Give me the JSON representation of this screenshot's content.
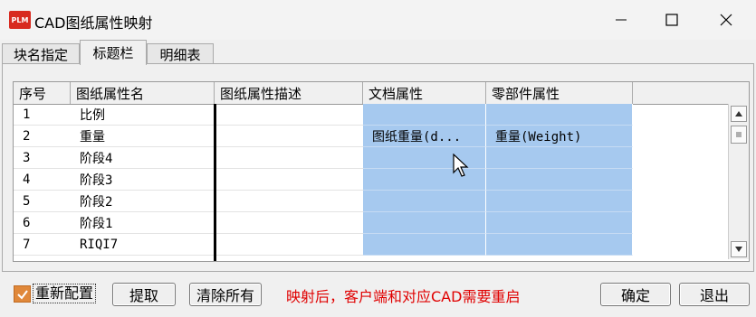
{
  "window": {
    "app_icon_text": "PLM",
    "title": "CAD图纸属性映射"
  },
  "tabs": [
    {
      "label": "块名指定",
      "active": false
    },
    {
      "label": "标题栏",
      "active": true
    },
    {
      "label": "明细表",
      "active": false
    }
  ],
  "table": {
    "columns": [
      "序号",
      "图纸属性名",
      "图纸属性描述",
      "文档属性",
      "零部件属性"
    ],
    "rows": [
      {
        "index": "1",
        "name": "比例",
        "desc": "",
        "doc": "",
        "part": ""
      },
      {
        "index": "2",
        "name": "重量",
        "desc": "",
        "doc": "图纸重量(d...",
        "part": "重量(Weight)"
      },
      {
        "index": "3",
        "name": "阶段4",
        "desc": "",
        "doc": "",
        "part": ""
      },
      {
        "index": "4",
        "name": "阶段3",
        "desc": "",
        "doc": "",
        "part": ""
      },
      {
        "index": "5",
        "name": "阶段2",
        "desc": "",
        "doc": "",
        "part": ""
      },
      {
        "index": "6",
        "name": "阶段1",
        "desc": "",
        "doc": "",
        "part": ""
      },
      {
        "index": "7",
        "name": "RIQI7",
        "desc": "",
        "doc": "",
        "part": ""
      }
    ]
  },
  "footer": {
    "reconfigure_label": "重新配置",
    "reconfigure_checked": true,
    "extract_label": "提取",
    "clear_all_label": "清除所有",
    "note": "映射后，客户端和对应CAD需要重启",
    "ok_label": "确定",
    "exit_label": "退出"
  }
}
